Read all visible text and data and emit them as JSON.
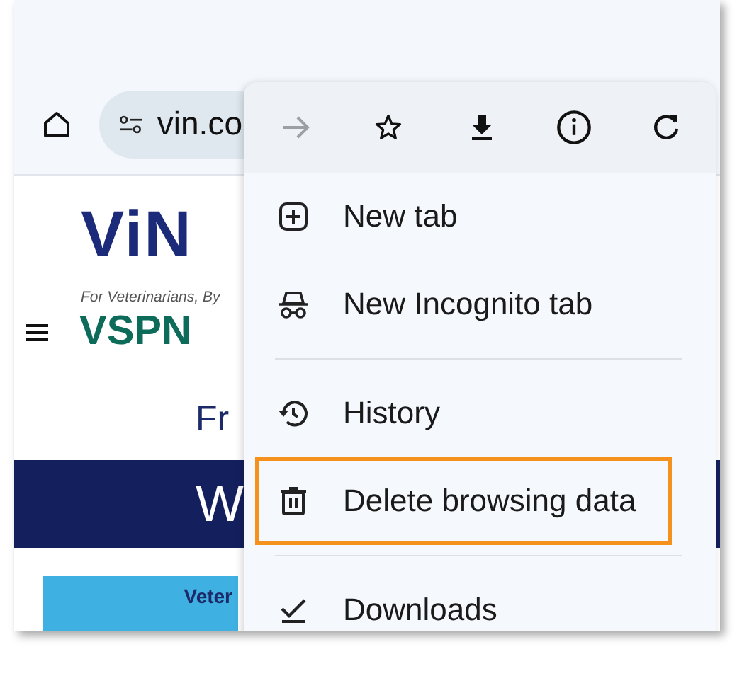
{
  "toolbar": {
    "url": "vin.co"
  },
  "page": {
    "logo": "ViN",
    "tagline": "For Veterinarians, By",
    "logo_2": "VSPN",
    "heading": "Fr",
    "banner_text": "W",
    "card_text": "Veter"
  },
  "menu": {
    "actions": [
      {
        "kind": "forward",
        "disabled": true
      },
      {
        "kind": "star",
        "disabled": false
      },
      {
        "kind": "download",
        "disabled": false
      },
      {
        "kind": "info",
        "disabled": false
      },
      {
        "kind": "reload",
        "disabled": false
      }
    ],
    "groups": [
      [
        {
          "kind": "new-tab",
          "label": "New tab",
          "highlighted": false
        },
        {
          "kind": "incognito",
          "label": "New Incognito tab",
          "highlighted": false
        }
      ],
      [
        {
          "kind": "history",
          "label": "History",
          "highlighted": false
        },
        {
          "kind": "delete",
          "label": "Delete browsing data",
          "highlighted": true
        }
      ],
      [
        {
          "kind": "downloads",
          "label": "Downloads",
          "highlighted": false
        }
      ]
    ]
  }
}
